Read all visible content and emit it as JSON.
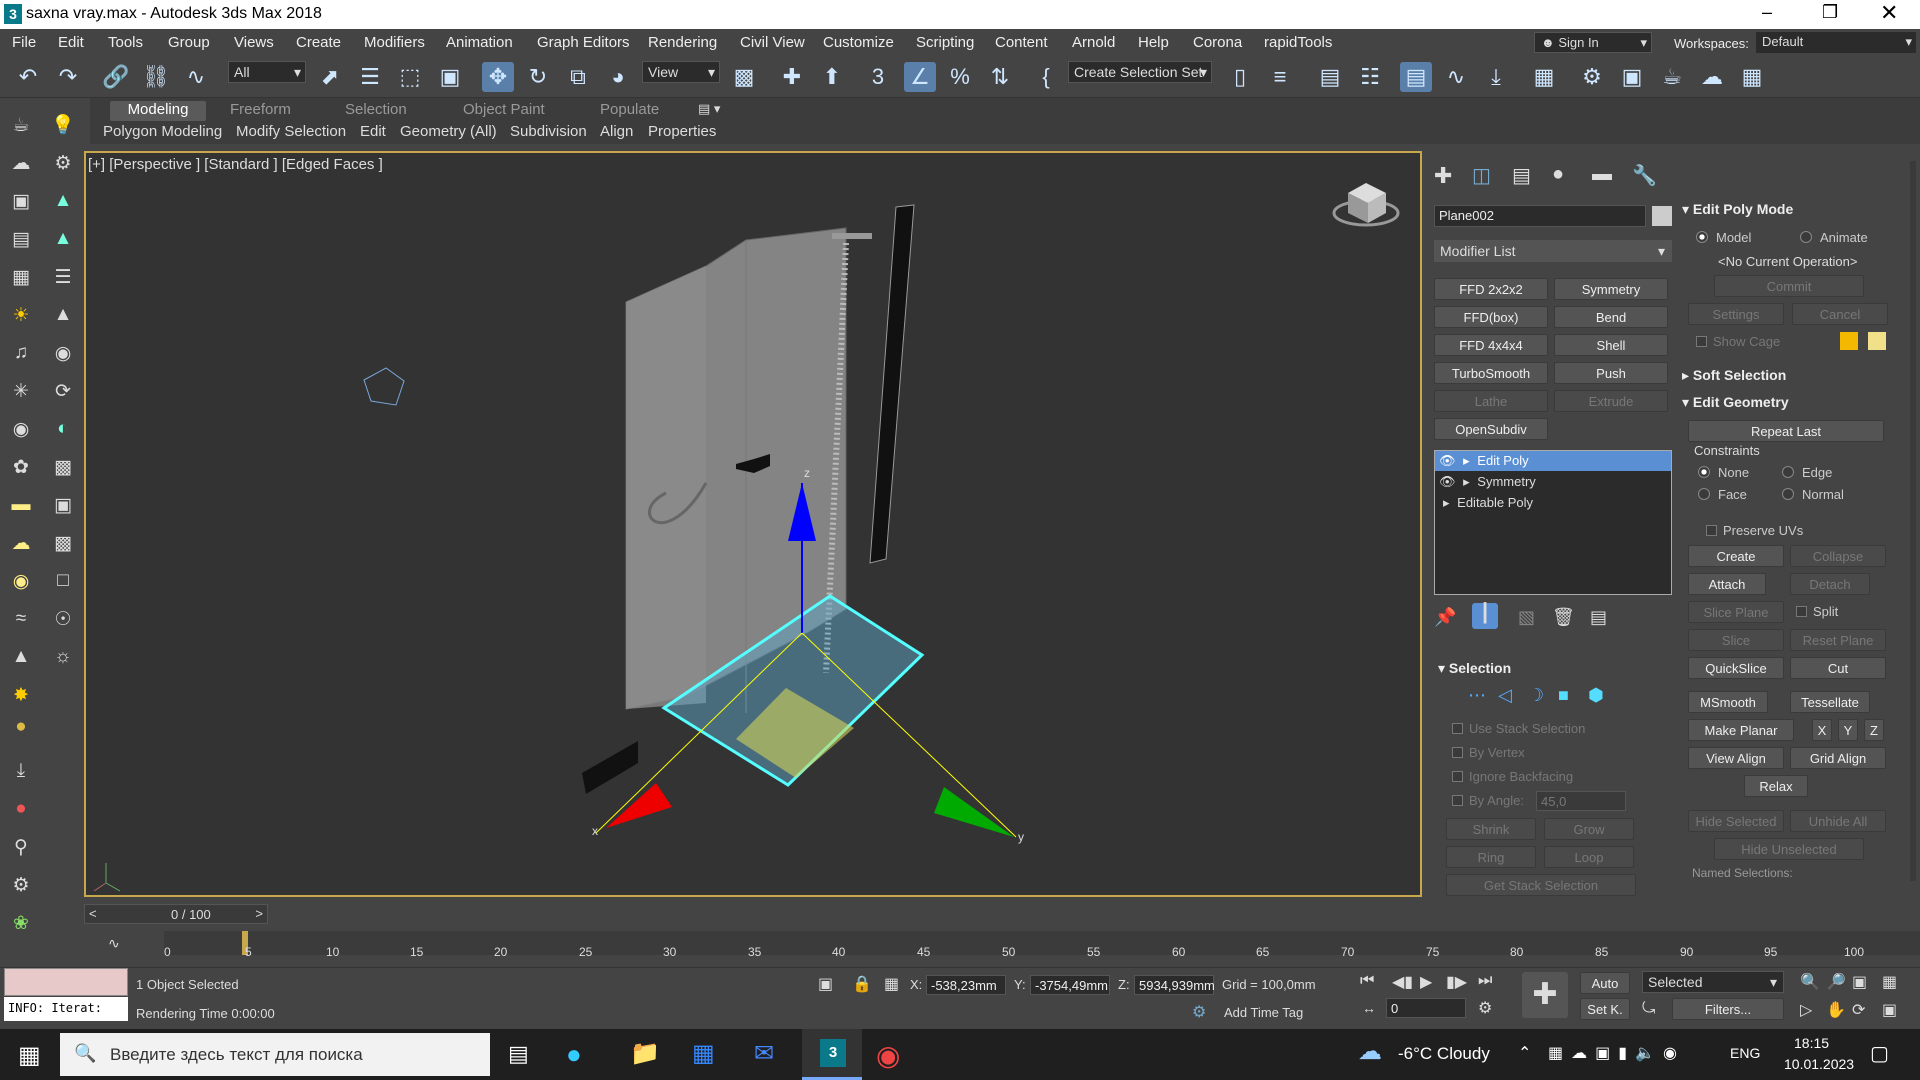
{
  "window": {
    "title": "saxna vray.max - Autodesk 3ds Max 2018",
    "app_icon": "3"
  },
  "menu": {
    "items": [
      "File",
      "Edit",
      "Tools",
      "Group",
      "Views",
      "Create",
      "Modifiers",
      "Animation",
      "Graph Editors",
      "Rendering",
      "Civil View",
      "Customize",
      "Scripting",
      "Content",
      "Arnold",
      "Help",
      "Corona",
      "rapidTools"
    ],
    "sign_in": "Sign In",
    "workspaces_label": "Workspaces:",
    "workspace_value": "Default"
  },
  "toolbar": {
    "filter_value": "All",
    "refcoord_value": "View",
    "selection_set": "Create Selection Set"
  },
  "ribbon": {
    "tabs": [
      "Modeling",
      "Freeform",
      "Selection",
      "Object Paint",
      "Populate"
    ],
    "subtabs": [
      "Polygon Modeling",
      "Modify Selection",
      "Edit",
      "Geometry (All)",
      "Subdivision",
      "Align",
      "Properties"
    ]
  },
  "viewport": {
    "label": "[+] [Perspective ] [Standard ] [Edged Faces ]",
    "axis_x": "x",
    "axis_y": "y",
    "axis_z": "z",
    "border_color": "#c8a84c"
  },
  "command_panel": {
    "object_name": "Plane002",
    "modifier_list": "Modifier List",
    "modifier_buttons": [
      {
        "label": "FFD 2x2x2",
        "enabled": true
      },
      {
        "label": "Symmetry",
        "enabled": true
      },
      {
        "label": "FFD(box)",
        "enabled": true
      },
      {
        "label": "Bend",
        "enabled": true
      },
      {
        "label": "FFD 4x4x4",
        "enabled": true
      },
      {
        "label": "Shell",
        "enabled": true
      },
      {
        "label": "TurboSmooth",
        "enabled": true
      },
      {
        "label": "Push",
        "enabled": true
      },
      {
        "label": "Lathe",
        "enabled": false
      },
      {
        "label": "Extrude",
        "enabled": false
      },
      {
        "label": "OpenSubdiv",
        "enabled": true
      }
    ],
    "stack": [
      {
        "label": "Edit Poly",
        "selected": true
      },
      {
        "label": "Symmetry",
        "selected": false
      },
      {
        "label": "Editable Poly",
        "selected": false
      }
    ],
    "selection_section": {
      "title": "Selection",
      "options": [
        "Use Stack Selection",
        "By Vertex",
        "Ignore Backfacing",
        "By Angle:"
      ],
      "angle_value": "45,0",
      "shrink": "Shrink",
      "grow": "Grow",
      "ring": "Ring",
      "loop": "Loop",
      "get_stack": "Get Stack Selection"
    }
  },
  "modify_panel": {
    "edit_poly_mode": {
      "title": "Edit Poly Mode",
      "model": "Model",
      "animate": "Animate",
      "current_op": "<No Current Operation>",
      "commit": "Commit",
      "settings": "Settings",
      "cancel": "Cancel",
      "show_cage": "Show Cage"
    },
    "soft_selection": "Soft Selection",
    "edit_geometry": {
      "title": "Edit Geometry",
      "repeat_last": "Repeat Last",
      "constraints_label": "Constraints",
      "constraints": [
        "None",
        "Edge",
        "Face",
        "Normal"
      ],
      "preserve_uvs": "Preserve UVs",
      "create": "Create",
      "collapse": "Collapse",
      "attach": "Attach",
      "detach": "Detach",
      "slice_plane": "Slice Plane",
      "split": "Split",
      "slice": "Slice",
      "reset_plane": "Reset Plane",
      "quickslice": "QuickSlice",
      "cut": "Cut",
      "msmooth": "MSmooth",
      "tessellate": "Tessellate",
      "make_planar": "Make Planar",
      "x": "X",
      "y": "Y",
      "z": "Z",
      "view_align": "View Align",
      "grid_align": "Grid Align",
      "relax": "Relax",
      "hide_selected": "Hide Selected",
      "unhide_all": "Unhide All",
      "hide_unselected": "Hide Unselected",
      "named_selections": "Named Selections:"
    }
  },
  "timeline": {
    "frame_counter": "0 / 100",
    "ticks": [
      "0",
      "5",
      "10",
      "15",
      "20",
      "25",
      "30",
      "35",
      "40",
      "45",
      "50",
      "55",
      "60",
      "65",
      "70",
      "75",
      "80",
      "85",
      "90",
      "95",
      "100"
    ]
  },
  "status": {
    "script_output": "INFO: Iterat:",
    "objects_selected": "1 Object Selected",
    "rendering_time": "Rendering Time  0:00:00",
    "x_label": "X:",
    "x_value": "-538,23mm",
    "y_label": "Y:",
    "y_value": "-3754,49mm",
    "z_label": "Z:",
    "z_value": "5934,939mm",
    "grid": "Grid = 100,0mm",
    "add_time_tag": "Add Time Tag",
    "auto": "Auto",
    "set_key": "Set K.",
    "selected_value": "Selected",
    "filters": "Filters...",
    "frame_value": "0"
  },
  "taskbar": {
    "search_placeholder": "Введите здесь текст для поиска",
    "weather": "-6°C  Cloudy",
    "lang": "ENG",
    "time": "18:15",
    "date": "10.01.2023"
  }
}
